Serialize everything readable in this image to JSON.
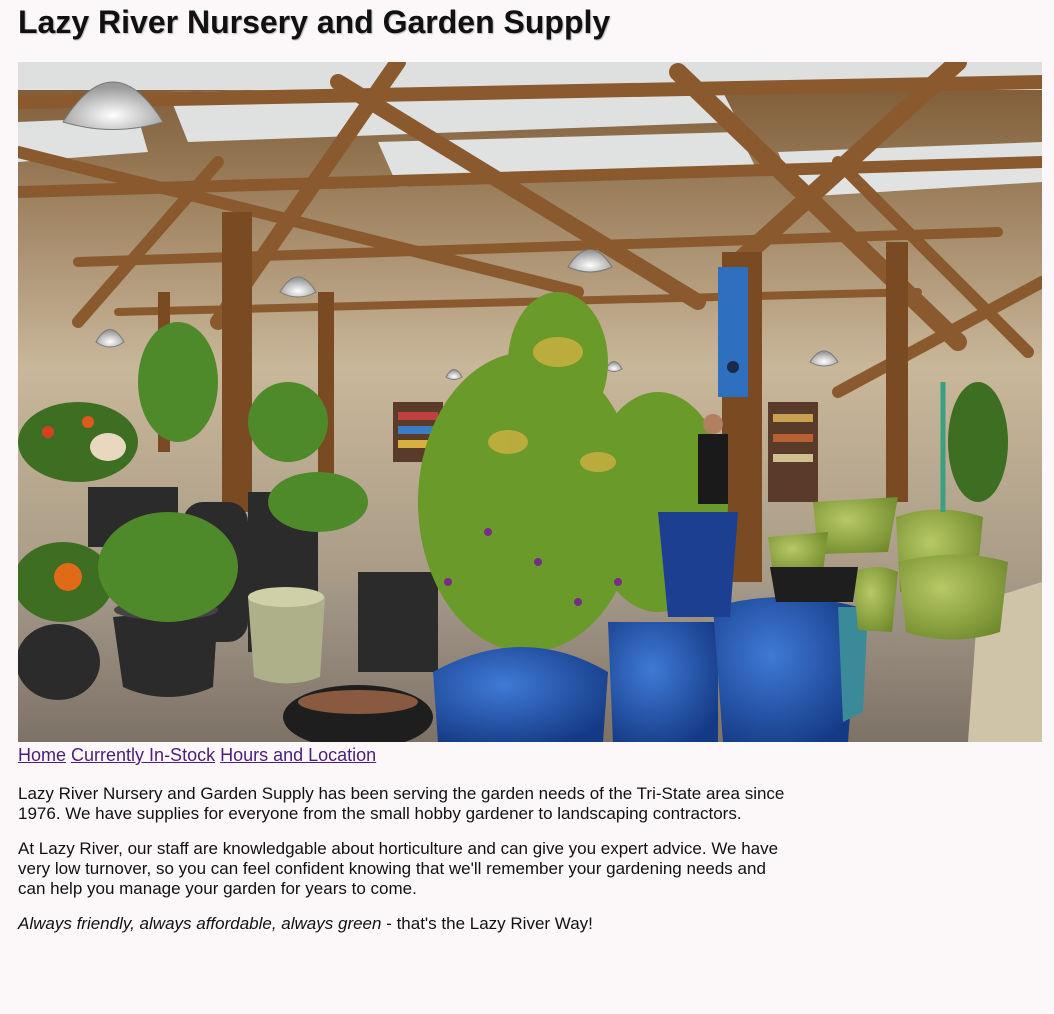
{
  "page": {
    "title": "Lazy River Nursery and Garden Supply"
  },
  "hero": {
    "colors": {
      "wood": "#8a5a2e",
      "wood_dark": "#5a3416",
      "skylight": "#e9eef2",
      "pot_blue": "#1f4fa8",
      "pot_green": "#9bb04a",
      "foliage": "#4f8a2a",
      "gravel": "#9a8f80"
    }
  },
  "nav": {
    "links": [
      "Home",
      "Currently In-Stock",
      "Hours and Location"
    ]
  },
  "content": {
    "paragraph1": "Lazy River Nursery and Garden Supply has been serving the garden needs of the Tri-State area since 1976. We have supplies for everyone from the small hobby gardener to landscaping contractors.",
    "paragraph2": "At Lazy River, our staff are knowledgable about horticulture and can give you expert advice. We have very low turnover, so you can feel confident knowing that we'll remember your gardening needs and can help you manage your garden for years to come.",
    "tagline_emphasis": "Always friendly, always affordable, always green",
    "tagline_rest": " - that's the Lazy River Way!"
  }
}
